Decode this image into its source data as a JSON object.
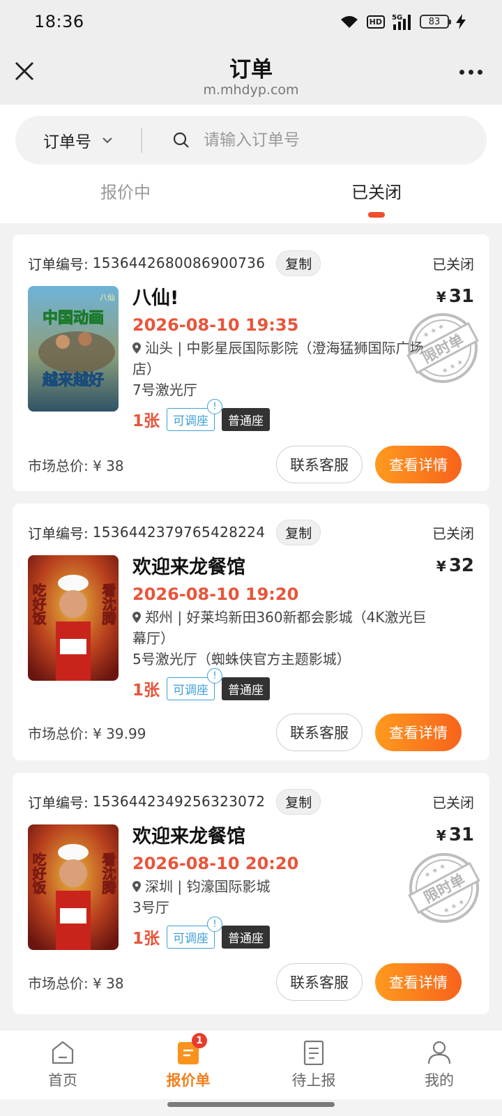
{
  "status_bar": {
    "time": "18:36",
    "hd": "HD",
    "network": "5G",
    "battery": "83"
  },
  "title_bar": {
    "title": "订单",
    "subtitle": "m.mhdyp.com"
  },
  "search": {
    "type_label": "订单号",
    "placeholder": "请输入订单号"
  },
  "tabs": [
    {
      "label": "报价中",
      "active": false
    },
    {
      "label": "已关闭",
      "active": true
    }
  ],
  "orders": [
    {
      "order_label": "订单编号:",
      "order_no": "1536442680086900736",
      "copy_label": "复制",
      "status": "已关闭",
      "title": "八仙!",
      "showtime": "2026-08-10 19:35",
      "cinema": "汕头 | 中影星辰国际影院（澄海猛狮国际广场店）",
      "hall": "7号激光厅",
      "quantity": "1张",
      "adjustable": "可调座",
      "seat_type": "普通座",
      "price_symbol": "¥",
      "price": "31",
      "limited_stamp": "限时单",
      "market_price": "市场总价: ¥ 38",
      "service_label": "联系客服",
      "detail_label": "查看详情",
      "poster": {
        "line1": "中国动画",
        "line2": "越来越好",
        "tag": "八仙"
      }
    },
    {
      "order_label": "订单编号:",
      "order_no": "1536442379765428224",
      "copy_label": "复制",
      "status": "已关闭",
      "title": "欢迎来龙餐馆",
      "showtime": "2026-08-10 19:20",
      "cinema": "郑州 | 好莱坞新田360新都会影城（4K激光巨幕厅）",
      "hall": "5号激光厅（蜘蛛侠官方主题影城）",
      "quantity": "1张",
      "adjustable": "可调座",
      "seat_type": "普通座",
      "price_symbol": "¥",
      "price": "32",
      "limited_stamp": "",
      "market_price": "市场总价: ¥ 39.99",
      "service_label": "联系客服",
      "detail_label": "查看详情",
      "poster": {
        "line1": "吃好饭",
        "line2": "看沈腾",
        "tag": ""
      }
    },
    {
      "order_label": "订单编号:",
      "order_no": "1536442349256323072",
      "copy_label": "复制",
      "status": "已关闭",
      "title": "欢迎来龙餐馆",
      "showtime": "2026-08-10 20:20",
      "cinema": "深圳 | 钧濠国际影城",
      "hall": "3号厅",
      "quantity": "1张",
      "adjustable": "可调座",
      "seat_type": "普通座",
      "price_symbol": "¥",
      "price": "31",
      "limited_stamp": "限时单",
      "market_price": "市场总价: ¥ 38",
      "service_label": "联系客服",
      "detail_label": "查看详情",
      "poster": {
        "line1": "吃好饭",
        "line2": "看沈腾",
        "tag": ""
      }
    }
  ],
  "bottom_nav": [
    {
      "label": "首页",
      "icon": "home-icon",
      "active": false
    },
    {
      "label": "报价单",
      "icon": "quote-list-icon",
      "active": true,
      "badge": "1"
    },
    {
      "label": "待上报",
      "icon": "document-icon",
      "active": false
    },
    {
      "label": "我的",
      "icon": "user-icon",
      "active": false
    }
  ],
  "colors": {
    "accent": "#e8553a",
    "button_orange": "#f7631c",
    "tab_underline": "#ee4e2c",
    "nav_active": "#f0801e",
    "link_blue": "#3ea0d8"
  }
}
